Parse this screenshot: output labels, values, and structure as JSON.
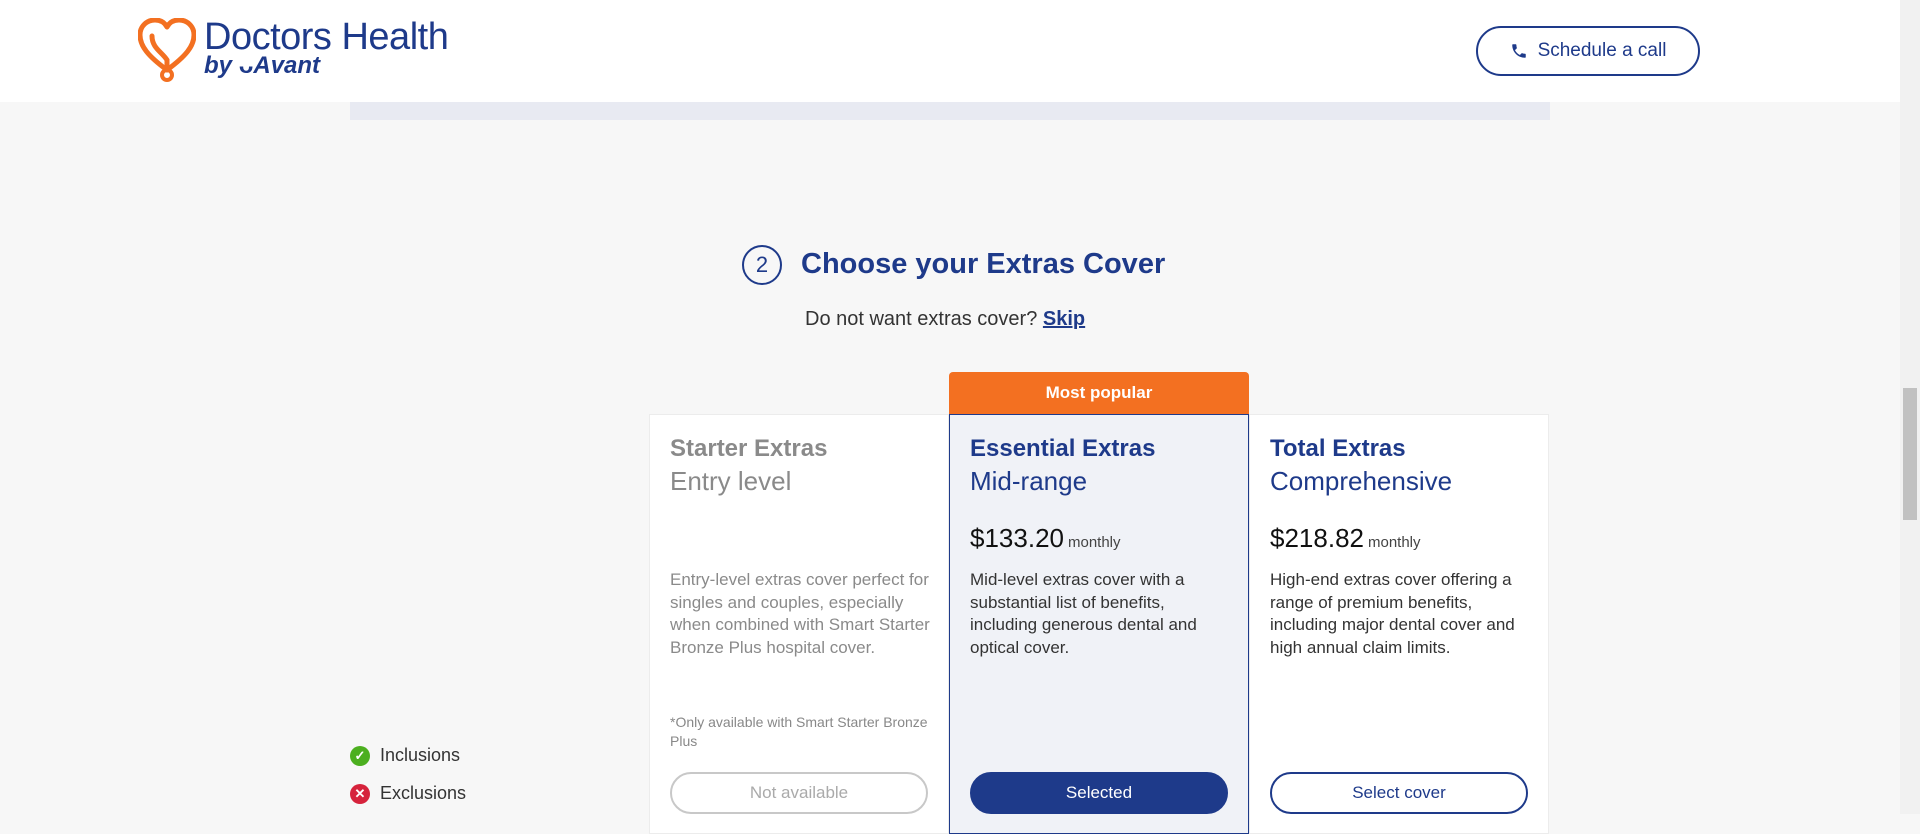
{
  "header": {
    "logo_title": "Doctors Health",
    "logo_sub_prefix": "by",
    "logo_sub_brand": "Avant",
    "schedule_label": "Schedule a call"
  },
  "section": {
    "step_number": "2",
    "title": "Choose your Extras Cover",
    "skip_prompt": "Do not want extras cover?",
    "skip_link": "Skip"
  },
  "legend": {
    "inclusions": "Inclusions",
    "exclusions": "Exclusions"
  },
  "plans": [
    {
      "name": "Starter Extras",
      "tier": "Entry level",
      "description": "Entry-level extras cover perfect for singles and couples, especially when combined with Smart Starter Bronze Plus hospital cover.",
      "note": "*Only available with Smart Starter Bronze Plus",
      "button": "Not available"
    },
    {
      "banner": "Most popular",
      "name": "Essential Extras",
      "tier": "Mid-range",
      "price": "$133.20",
      "frequency": "monthly",
      "description": "Mid-level extras cover with a substantial list of benefits, including generous dental and optical cover.",
      "button": "Selected"
    },
    {
      "name": "Total Extras",
      "tier": "Comprehensive",
      "price": "$218.82",
      "frequency": "monthly",
      "description": "High-end extras cover offering a range of premium benefits, including major dental cover and high annual claim limits.",
      "button": "Select cover"
    }
  ],
  "colors": {
    "brand_blue": "#1e3a8a",
    "brand_orange": "#f37021",
    "inclusion_green": "#4caf1f",
    "exclusion_red": "#d6233c"
  },
  "icons": {
    "logo": "heart-stethoscope-icon",
    "schedule": "phone-icon",
    "inclusion": "check-circle-icon",
    "exclusion": "x-circle-icon"
  }
}
